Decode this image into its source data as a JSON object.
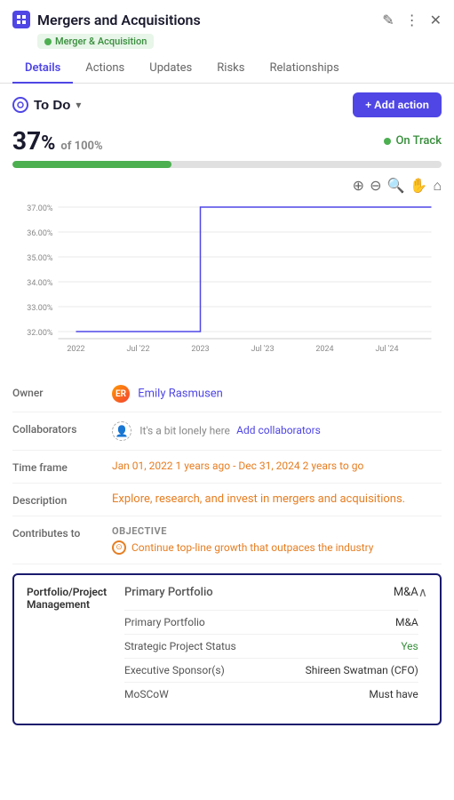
{
  "header": {
    "title": "Mergers and Acquisitions",
    "tag": "Merger & Acquisition",
    "edit_icon": "✎",
    "more_icon": "⋮",
    "close_icon": "✕"
  },
  "tabs": [
    {
      "label": "Details",
      "active": true
    },
    {
      "label": "Actions",
      "active": false
    },
    {
      "label": "Updates",
      "active": false
    },
    {
      "label": "Risks",
      "active": false
    },
    {
      "label": "Relationships",
      "active": false
    }
  ],
  "status": {
    "label": "To Do",
    "add_action_label": "+ Add action"
  },
  "progress": {
    "percentage": "37",
    "of_label": "of 100%",
    "on_track_label": "On Track",
    "bar_fill_pct": 37
  },
  "chart": {
    "y_labels": [
      "37.00%",
      "36.00%",
      "35.00%",
      "34.00%",
      "33.00%",
      "32.00%"
    ],
    "x_labels": [
      "2022",
      "Jul '22",
      "2023",
      "Jul '23",
      "2024",
      "Jul '24"
    ]
  },
  "details": {
    "owner_label": "Owner",
    "owner_name": "Emily Rasmusen",
    "owner_initials": "ER",
    "collaborators_label": "Collaborators",
    "collaborators_text": "It's a bit lonely here",
    "add_collaborators_label": "Add collaborators",
    "timeframe_label": "Time frame",
    "timeframe_value": "Jan 01, 2022 1 years ago - Dec 31, 2024 2 years to go",
    "description_label": "Description",
    "description_value": "Explore, research, and invest in mergers and acquisitions.",
    "contributes_label": "Contributes to",
    "objective_label": "OBJECTIVE",
    "objective_text": "Continue top-line growth that outpaces the industry"
  },
  "portfolio": {
    "section_title": "Portfolio/Project\nManagement",
    "main_label": "Primary Portfolio",
    "main_value": "M&A",
    "collapse_icon": "∧",
    "sub_rows": [
      {
        "label": "Primary Portfolio",
        "value": "M&A",
        "value_class": ""
      },
      {
        "label": "Strategic Project Status",
        "value": "Yes",
        "value_class": "green"
      },
      {
        "label": "Executive Sponsor(s)",
        "value": "Shireen Swatman (CFO)",
        "value_class": ""
      },
      {
        "label": "MoSCoW",
        "value": "Must have",
        "value_class": ""
      }
    ]
  }
}
